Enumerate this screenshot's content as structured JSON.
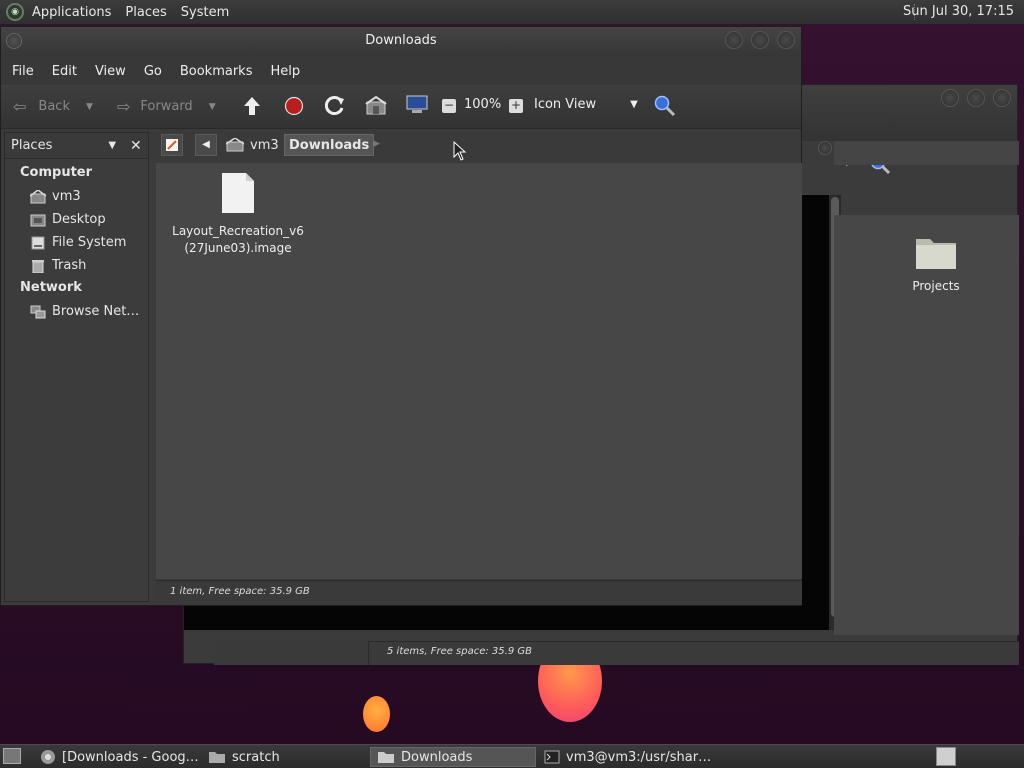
{
  "topbar": {
    "menus": [
      "Applications",
      "Places",
      "System"
    ],
    "clock": "Sun Jul 30, 17:15"
  },
  "background_window": {
    "status": "5 items, Free space: 35.9 GB",
    "folder_label": "Projects"
  },
  "window": {
    "title": "Downloads",
    "menu": [
      "File",
      "Edit",
      "View",
      "Go",
      "Bookmarks",
      "Help"
    ],
    "toolbar": {
      "back": "Back",
      "forward": "Forward",
      "zoom": "100%",
      "view_mode": "Icon View"
    },
    "path": {
      "home": "vm3",
      "current": "Downloads"
    },
    "sidebar": {
      "header": "Places",
      "computer_label": "Computer",
      "computer_items": [
        "vm3",
        "Desktop",
        "File System",
        "Trash"
      ],
      "network_label": "Network",
      "network_items": [
        "Browse Net…"
      ]
    },
    "files": [
      {
        "name_line1": "Layout_Recreation_v6",
        "name_line2": "(27June03).image"
      }
    ],
    "status": "1 item, Free space: 35.9 GB"
  },
  "taskbar": {
    "tasks": [
      "[Downloads - Goog…",
      "scratch",
      "Downloads",
      "vm3@vm3:/usr/shar…"
    ]
  },
  "colors": {
    "wallpaper": "#2a0f26",
    "panel": "#333333",
    "accent_red": "#cc2222"
  }
}
